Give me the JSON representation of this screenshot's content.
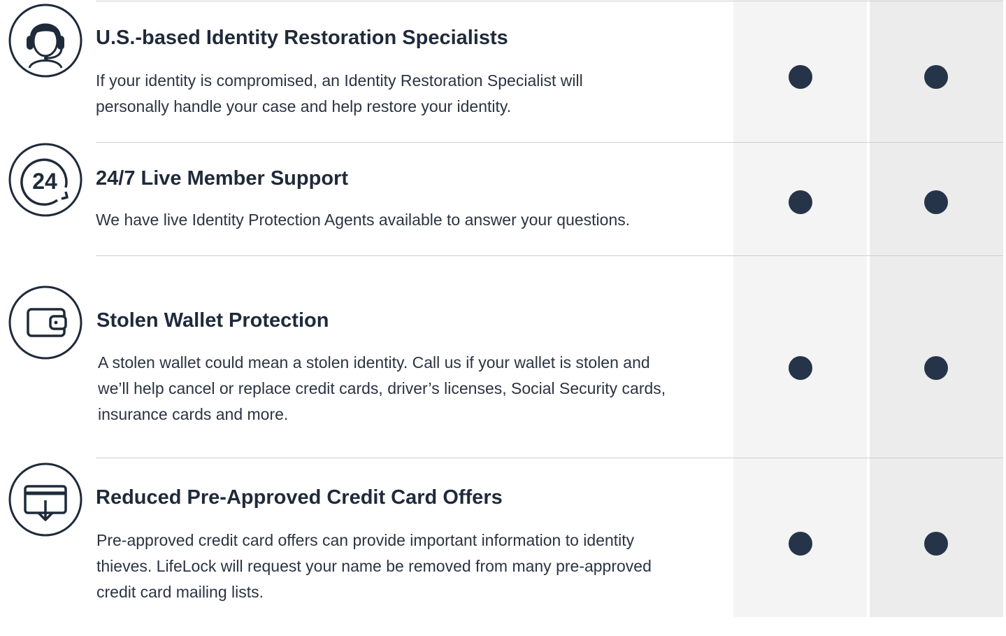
{
  "features": [
    {
      "id": "identity-restoration",
      "icon": "headset-icon",
      "title": "U.S.-based Identity Restoration Specialists",
      "description": "If your identity is compromised, an Identity Restoration Specialist will personally handle your case and help restore your identity."
    },
    {
      "id": "live-support",
      "icon": "clock-24-icon",
      "icon_text": "24",
      "title": "24/7 Live Member Support",
      "description": "We have live Identity Protection Agents available to answer your questions."
    },
    {
      "id": "stolen-wallet",
      "icon": "wallet-icon",
      "title": "Stolen Wallet Protection",
      "description": "A stolen wallet could mean a stolen identity. Call us if your wallet is stolen and we’ll help cancel or replace credit cards, driver’s licenses, Social Security cards, insurance cards and more."
    },
    {
      "id": "credit-offers",
      "icon": "credit-card-download-icon",
      "title": "Reduced Pre-Approved Credit Card Offers",
      "description": "Pre-approved credit card offers can provide important information to identity thieves. LifeLock will request your name be removed from many pre-approved credit card mailing lists."
    }
  ],
  "colors": {
    "text": "#1f2a3a",
    "dot": "#26344a",
    "column_a": "#f4f4f4",
    "column_b": "#ececec",
    "divider": "#cfcfcf"
  }
}
